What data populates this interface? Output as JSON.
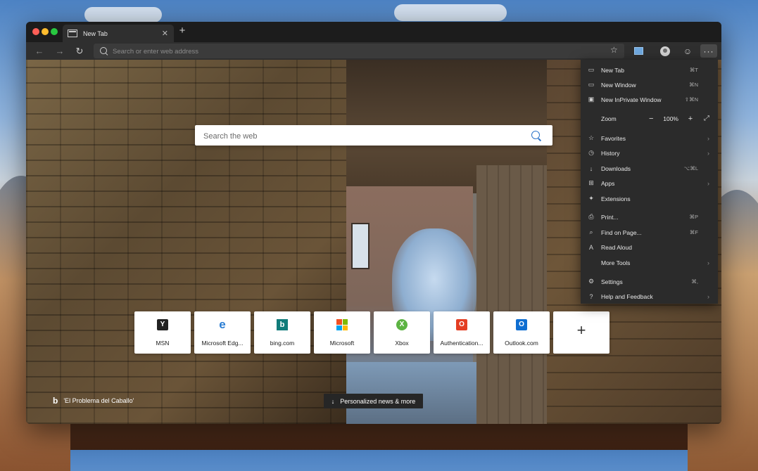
{
  "tab": {
    "title": "New Tab"
  },
  "address": {
    "placeholder": "Search or enter web address"
  },
  "search": {
    "placeholder": "Search the web"
  },
  "tiles": [
    {
      "label": "MSN",
      "icon": "msn-icon"
    },
    {
      "label": "Microsoft Edg...",
      "icon": "edge-icon"
    },
    {
      "label": "bing.com",
      "icon": "bing-icon"
    },
    {
      "label": "Microsoft",
      "icon": "microsoft-icon"
    },
    {
      "label": "Xbox",
      "icon": "xbox-icon"
    },
    {
      "label": "Authentication...",
      "icon": "office-icon"
    },
    {
      "label": "Outlook.com",
      "icon": "outlook-icon"
    }
  ],
  "add_tile": {
    "label": "+"
  },
  "image_credit": {
    "text": "'El Problema del Caballo'"
  },
  "news_button": {
    "label": "Personalized news & more"
  },
  "menu": {
    "new_tab": {
      "label": "New Tab",
      "shortcut": "⌘T"
    },
    "new_window": {
      "label": "New Window",
      "shortcut": "⌘N"
    },
    "new_inprivate": {
      "label": "New InPrivate Window",
      "shortcut": "⇧⌘N"
    },
    "zoom": {
      "label": "Zoom",
      "value": "100%"
    },
    "favorites": {
      "label": "Favorites"
    },
    "history": {
      "label": "History"
    },
    "downloads": {
      "label": "Downloads",
      "shortcut": "⌥⌘L"
    },
    "apps": {
      "label": "Apps"
    },
    "extensions": {
      "label": "Extensions"
    },
    "print": {
      "label": "Print...",
      "shortcut": "⌘P"
    },
    "find": {
      "label": "Find on Page...",
      "shortcut": "⌘F"
    },
    "read_aloud": {
      "label": "Read Aloud"
    },
    "more_tools": {
      "label": "More Tools"
    },
    "settings": {
      "label": "Settings",
      "shortcut": "⌘,"
    },
    "help": {
      "label": "Help and Feedback"
    }
  },
  "colors": {
    "menu_bg": "#2b2b2b",
    "toolbar_bg": "#2f2f2f",
    "accent_blue": "#2b73c9"
  }
}
